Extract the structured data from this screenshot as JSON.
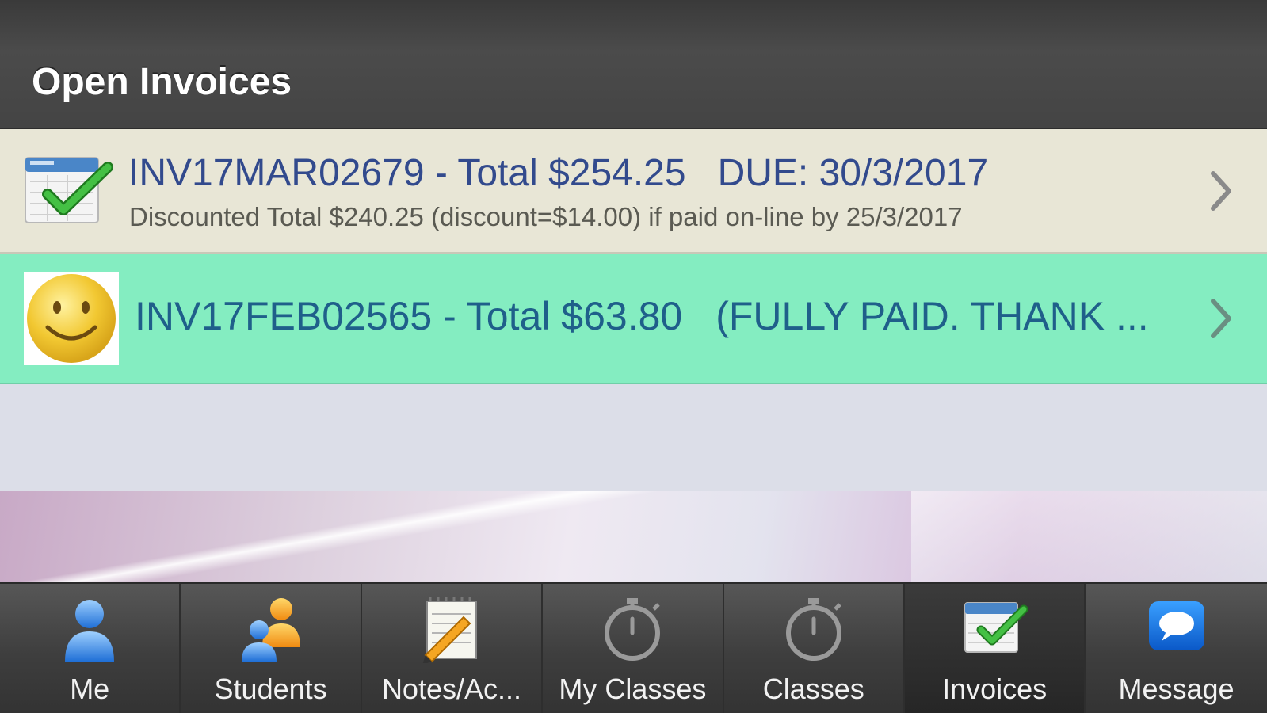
{
  "header": {
    "title": "Open Invoices"
  },
  "invoices": [
    {
      "id_total": "INV17MAR02679 - Total $254.25",
      "due": "DUE: 30/3/2017",
      "discount_note": "Discounted Total $240.25 (discount=$14.00)  if paid on-line by 25/3/2017",
      "icon": "invoice-check-icon",
      "background": "#e8e6d6"
    },
    {
      "id_total": "INV17FEB02565 - Total $63.80",
      "status": "(FULLY PAID. THANK ...",
      "icon": "smiley-icon",
      "background": "#84edc1"
    }
  ],
  "tabs": [
    {
      "label": "Me",
      "icon": "person-icon"
    },
    {
      "label": "Students",
      "icon": "people-icon"
    },
    {
      "label": "Notes/Ac...",
      "icon": "notepad-pencil-icon"
    },
    {
      "label": "My Classes",
      "icon": "stopwatch-icon"
    },
    {
      "label": "Classes",
      "icon": "stopwatch-icon"
    },
    {
      "label": "Invoices",
      "icon": "invoice-check-icon",
      "active": true
    },
    {
      "label": "Message",
      "icon": "speech-bubble-icon"
    }
  ],
  "colors": {
    "header_bg": "#444444",
    "invoice_text": "#324a8d",
    "paid_text": "#1f5f8a",
    "unpaid_row": "#e8e6d6",
    "paid_row": "#84edc1"
  }
}
